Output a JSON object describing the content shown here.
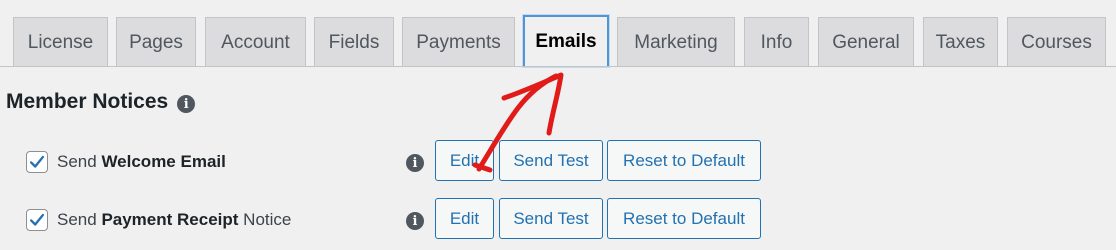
{
  "tabs": [
    {
      "label": "License"
    },
    {
      "label": "Pages"
    },
    {
      "label": "Account"
    },
    {
      "label": "Fields"
    },
    {
      "label": "Payments"
    },
    {
      "label": "Emails",
      "active": true
    },
    {
      "label": "Marketing"
    },
    {
      "label": "Info"
    },
    {
      "label": "General"
    },
    {
      "label": "Taxes"
    },
    {
      "label": "Courses"
    }
  ],
  "section": {
    "title": "Member Notices",
    "info_icon": "i"
  },
  "notices": [
    {
      "checked": true,
      "prefix": "Send ",
      "name": "Welcome Email",
      "suffix": "",
      "info_icon": "i",
      "edit_label": "Edit",
      "send_test_label": "Send Test",
      "reset_label": "Reset to Default"
    },
    {
      "checked": true,
      "prefix": "Send ",
      "name": "Payment Receipt",
      "suffix": " Notice",
      "info_icon": "i",
      "edit_label": "Edit",
      "send_test_label": "Send Test",
      "reset_label": "Reset to Default"
    }
  ],
  "colors": {
    "accent": "#2271b1",
    "annotation_arrow": "#e11a1a",
    "active_tab_border": "#4f94d4"
  }
}
